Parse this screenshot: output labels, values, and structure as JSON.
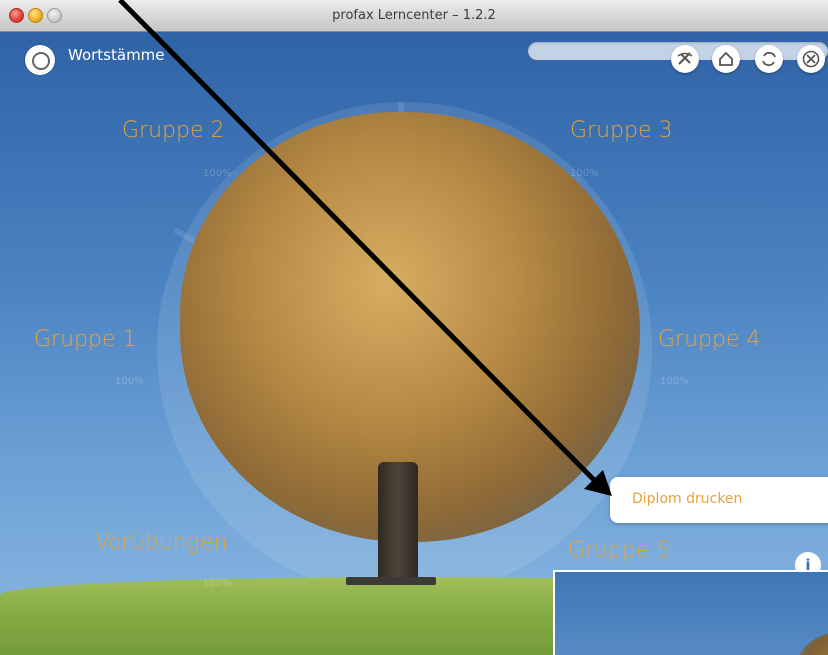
{
  "window": {
    "title": "profax Lerncenter – 1.2.2"
  },
  "header": {
    "section_title": "Wortstämme"
  },
  "controls": [
    "tools-icon",
    "home-icon",
    "refresh-icon",
    "close-icon"
  ],
  "groups": [
    {
      "name": "Gruppe 2",
      "percent": "100%"
    },
    {
      "name": "Gruppe 3",
      "percent": "100%"
    },
    {
      "name": "Gruppe 1",
      "percent": "100%"
    },
    {
      "name": "Gruppe 4",
      "percent": "100%"
    },
    {
      "name": "Vorübungen",
      "percent": "100%"
    },
    {
      "name": "Gruppe 5",
      "percent": ""
    }
  ],
  "popup": {
    "label": "Diplom drucken"
  },
  "info_label": "i",
  "colors": {
    "accent": "#e8a23c",
    "sky": "#3b6fb0"
  }
}
